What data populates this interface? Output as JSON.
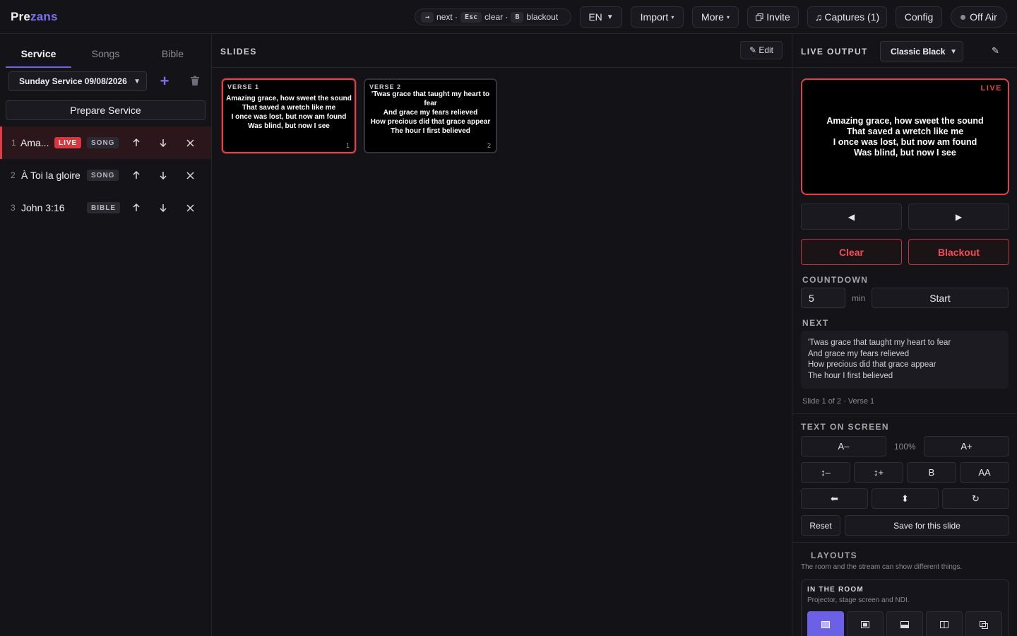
{
  "app": {
    "logo_prefix": "Pre",
    "logo_suffix": "zans"
  },
  "topbar": {
    "hints": [
      {
        "key": "→",
        "label": "next ·"
      },
      {
        "key": "Esc",
        "label": "clear ·"
      },
      {
        "key": "B",
        "label": "blackout"
      }
    ],
    "language": "EN",
    "import_label": "Import",
    "more_label": "More",
    "invite_label": "Invite",
    "captures_label": "Captures (1)",
    "config_label": "Config",
    "offair_label": "Off Air"
  },
  "left": {
    "tabs": [
      "Service",
      "Songs",
      "Bible"
    ],
    "service_select": "Sunday Service 09/08/2026",
    "prepare_label": "Prepare Service",
    "items": [
      {
        "num": "1",
        "title": "Ama...",
        "live": "LIVE",
        "type": "SONG"
      },
      {
        "num": "2",
        "title": "À Toi la gloire",
        "type": "SONG"
      },
      {
        "num": "3",
        "title": "John 3:16",
        "type": "BIBLE"
      }
    ]
  },
  "center": {
    "title": "SLIDES",
    "edit_label": "✎ Edit",
    "slides": [
      {
        "label": "VERSE 1",
        "idx": "1",
        "lines": [
          "Amazing grace, how sweet the sound",
          "That saved a wretch like me",
          "I once was lost, but now am found",
          "Was blind, but now I see"
        ]
      },
      {
        "label": "VERSE 2",
        "idx": "2",
        "lines": [
          "'Twas grace that taught my heart to fear",
          "And grace my fears relieved",
          "How precious did that grace appear",
          "The hour I first believed"
        ]
      }
    ]
  },
  "right": {
    "title": "LIVE OUTPUT",
    "theme": "Classic Black",
    "live_tag": "LIVE",
    "preview_lines": [
      "Amazing grace, how sweet the sound",
      "That saved a wretch like me",
      "I once was lost, but now am found",
      "Was blind, but now I see"
    ],
    "prev_symbol": "◀",
    "next_symbol": "▶",
    "clear_label": "Clear",
    "blackout_label": "Blackout",
    "countdown_label": "COUNTDOWN",
    "countdown_value": "5",
    "countdown_unit": "min",
    "start_label": "Start",
    "next_label": "NEXT",
    "next_lines": [
      "'Twas grace that taught my heart to fear",
      "And grace my fears relieved",
      "How precious did that grace appear",
      "The hour I first believed"
    ],
    "slide_status": "Slide 1 of 2 · Verse 1",
    "text_on_screen_label": "TEXT ON SCREEN",
    "font_minus": "A–",
    "font_pct": "100%",
    "font_plus": "A+",
    "bold_label": "B",
    "caps_label": "AA",
    "reset_label": "Reset",
    "save_slide_label": "Save for this slide",
    "layouts_label": "LAYOUTS",
    "layouts_desc": "The room and the stream can show different things.",
    "in_room_label": "IN THE ROOM",
    "in_room_desc": "Projector, stage screen and NDI."
  },
  "colors": {
    "accent": "#6e63ea",
    "live": "#e2404b",
    "background": "#131217"
  }
}
